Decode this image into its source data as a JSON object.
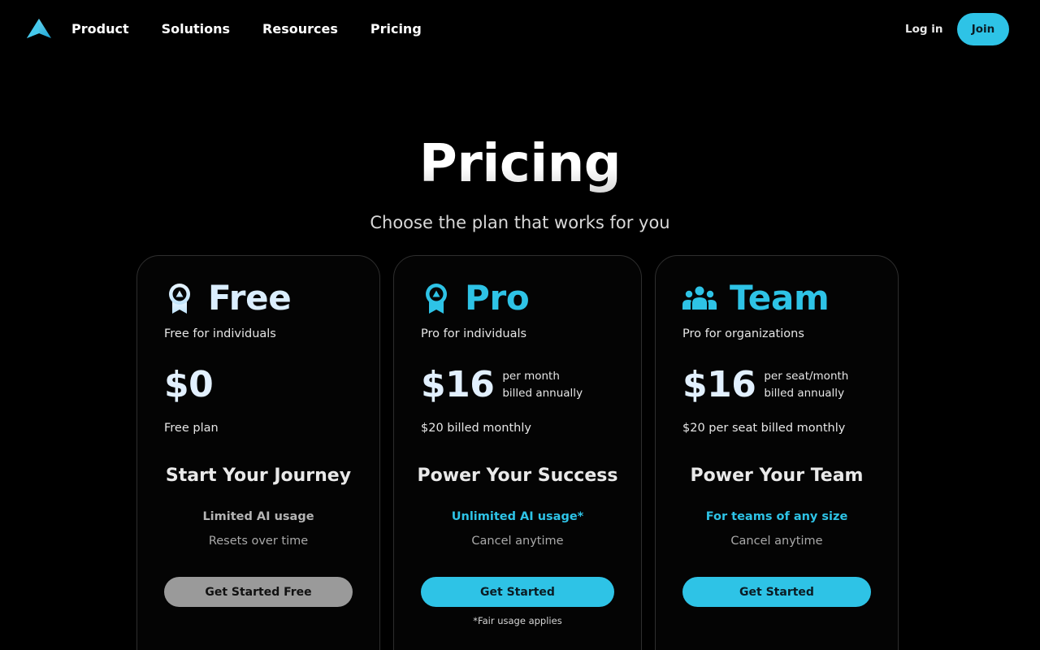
{
  "nav": {
    "links": [
      "Product",
      "Solutions",
      "Resources",
      "Pricing"
    ],
    "login_label": "Log in",
    "join_label": "Join"
  },
  "hero": {
    "title": "Pricing",
    "subtitle": "Choose the plan that works for you"
  },
  "plans": [
    {
      "name": "Free",
      "icon": "badge-icon",
      "tagline": "Free for individuals",
      "price": "$0",
      "price_note_1": "",
      "price_note_2": "",
      "billing": "Free plan",
      "headline": "Start Your Journey",
      "feature_1": "Limited AI usage",
      "feature_2": "Resets over time",
      "cta": "Get Started Free",
      "footnote": ""
    },
    {
      "name": "Pro",
      "icon": "badge-icon",
      "tagline": "Pro for individuals",
      "price": "$16",
      "price_note_1": "per month",
      "price_note_2": "billed annually",
      "billing": "$20 billed monthly",
      "headline": "Power Your Success",
      "feature_1": "Unlimited AI usage*",
      "feature_2": "Cancel anytime",
      "cta": "Get Started",
      "footnote": "*Fair usage applies"
    },
    {
      "name": "Team",
      "icon": "team-icon",
      "tagline": "Pro for organizations",
      "price": "$16",
      "price_note_1": "per seat/month",
      "price_note_2": "billed annually",
      "billing": "$20 per seat billed monthly",
      "headline": "Power Your Team",
      "feature_1": "For teams of any size",
      "feature_2": "Cancel anytime",
      "cta": "Get Started",
      "footnote": ""
    }
  ],
  "colors": {
    "accent": "#2ec3e6",
    "background": "#000000",
    "card_border": "#2e2e2e",
    "free_button": "#9a9a9a",
    "free_name": "#dbeefe"
  }
}
